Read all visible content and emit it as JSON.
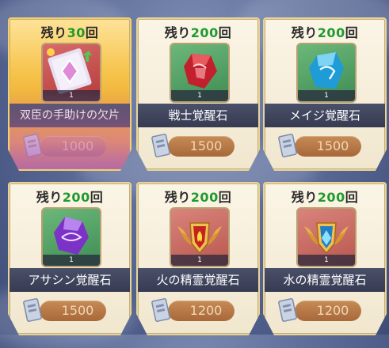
{
  "remain_label": "残り",
  "remain_unit": "回",
  "items": [
    {
      "name": "双臣の手助けの欠片",
      "remain": "30",
      "qty": "1",
      "price": "1000",
      "icon": "scroll-shard-icon",
      "highlight": true
    },
    {
      "name": "戦士覚醒石",
      "remain": "200",
      "qty": "1",
      "price": "1500",
      "icon": "red-crystal-icon"
    },
    {
      "name": "メイジ覚醒石",
      "remain": "200",
      "qty": "1",
      "price": "1500",
      "icon": "blue-crystal-icon"
    },
    {
      "name": "アサシン覚醒石",
      "remain": "200",
      "qty": "1",
      "price": "1500",
      "icon": "purple-crystal-icon"
    },
    {
      "name": "火の精霊覚醒石",
      "remain": "200",
      "qty": "1",
      "price": "1200",
      "icon": "fire-spirit-emblem-icon"
    },
    {
      "name": "水の精霊覚醒石",
      "remain": "200",
      "qty": "1",
      "price": "1200",
      "icon": "water-spirit-emblem-icon"
    }
  ],
  "colors": {
    "remain_number": "#1f9a2e",
    "name_bar": "#3c4157",
    "price_pill": "#b4743f"
  }
}
